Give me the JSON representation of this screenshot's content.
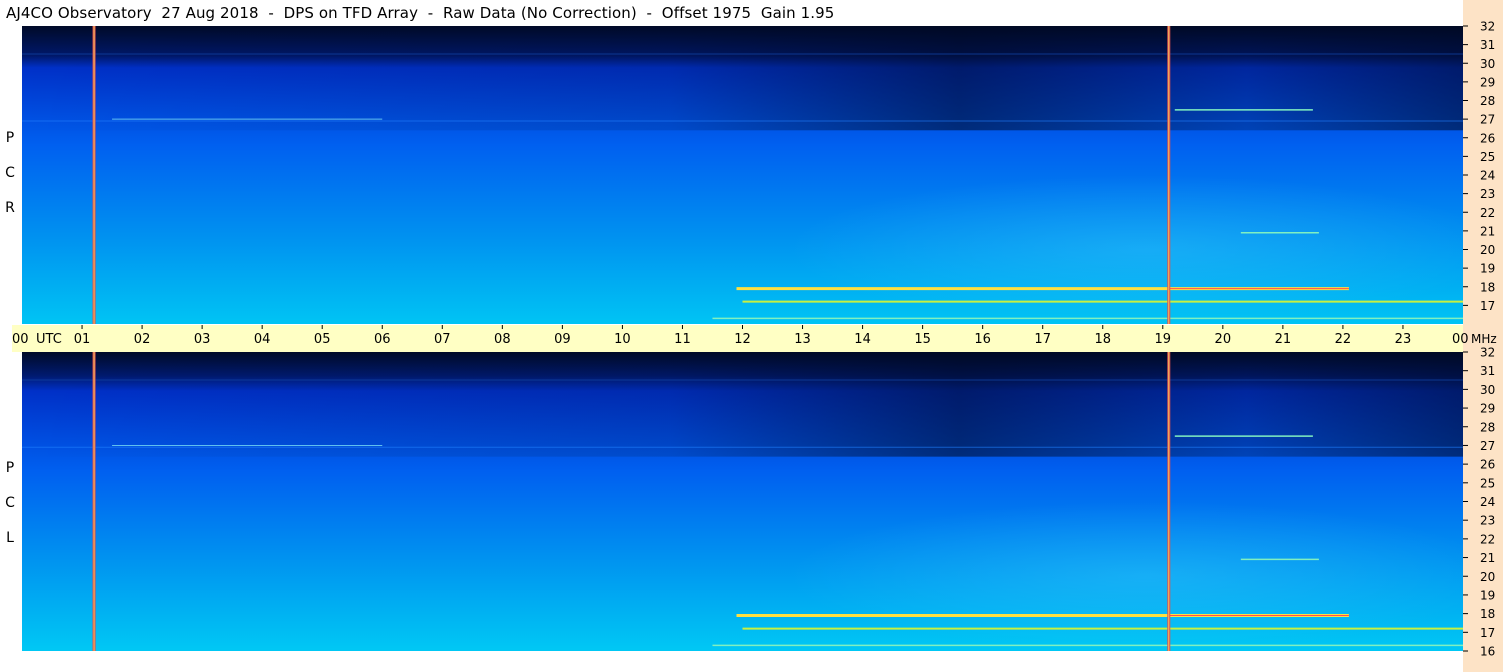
{
  "title": "AJ4CO Observatory  27 Aug 2018  -  DPS on TFD Array  -  Raw Data (No Correction)  -  Offset 1975  Gain 1.95",
  "panels": [
    {
      "id": "rcp",
      "label_letters": [
        "R",
        "C",
        "P"
      ]
    },
    {
      "id": "lcp",
      "label_letters": [
        "L",
        "C",
        "P"
      ]
    }
  ],
  "chart_data": {
    "type": "heatmap",
    "title": "AJ4CO Observatory  27 Aug 2018  -  DPS on TFD Array  -  Raw Data (No Correction)  -  Offset 1975  Gain 1.95",
    "x_unit_label": "UTC",
    "x_tick_labels": [
      "00",
      "01",
      "02",
      "03",
      "04",
      "05",
      "06",
      "07",
      "08",
      "09",
      "10",
      "11",
      "12",
      "13",
      "14",
      "15",
      "16",
      "17",
      "18",
      "19",
      "20",
      "21",
      "22",
      "23",
      "00"
    ],
    "x_range_hours": [
      0,
      24
    ],
    "y_unit_label": "MHz",
    "y_tick_labels": [
      "32",
      "31",
      "30",
      "29",
      "28",
      "27",
      "26",
      "25",
      "24",
      "23",
      "22",
      "21",
      "20",
      "19",
      "18",
      "17",
      "16"
    ],
    "y_range_mhz": [
      16,
      32
    ],
    "panels": [
      "RCP",
      "LCP"
    ],
    "colormap": [
      "#000a28",
      "#0018c8",
      "#0050f0",
      "#0090f0",
      "#00c8f0",
      "#40e0c0",
      "#ffff40",
      "#ff6060"
    ],
    "vertical_markers_utc": [
      1.2,
      19.1
    ],
    "interference_lines": [
      {
        "freq_mhz": 17.9,
        "start_utc": 11.9,
        "end_utc": 22.1,
        "intensity": "strong"
      },
      {
        "freq_mhz": 17.2,
        "start_utc": 12.0,
        "end_utc": 24.0,
        "intensity": "medium"
      },
      {
        "freq_mhz": 16.3,
        "start_utc": 11.5,
        "end_utc": 24.0,
        "intensity": "weak"
      },
      {
        "freq_mhz": 27.5,
        "start_utc": 19.2,
        "end_utc": 21.5,
        "intensity": "weak"
      },
      {
        "freq_mhz": 27.0,
        "start_utc": 1.5,
        "end_utc": 6.0,
        "intensity": "faint"
      },
      {
        "freq_mhz": 20.9,
        "start_utc": 20.3,
        "end_utc": 21.6,
        "intensity": "weak"
      }
    ]
  }
}
